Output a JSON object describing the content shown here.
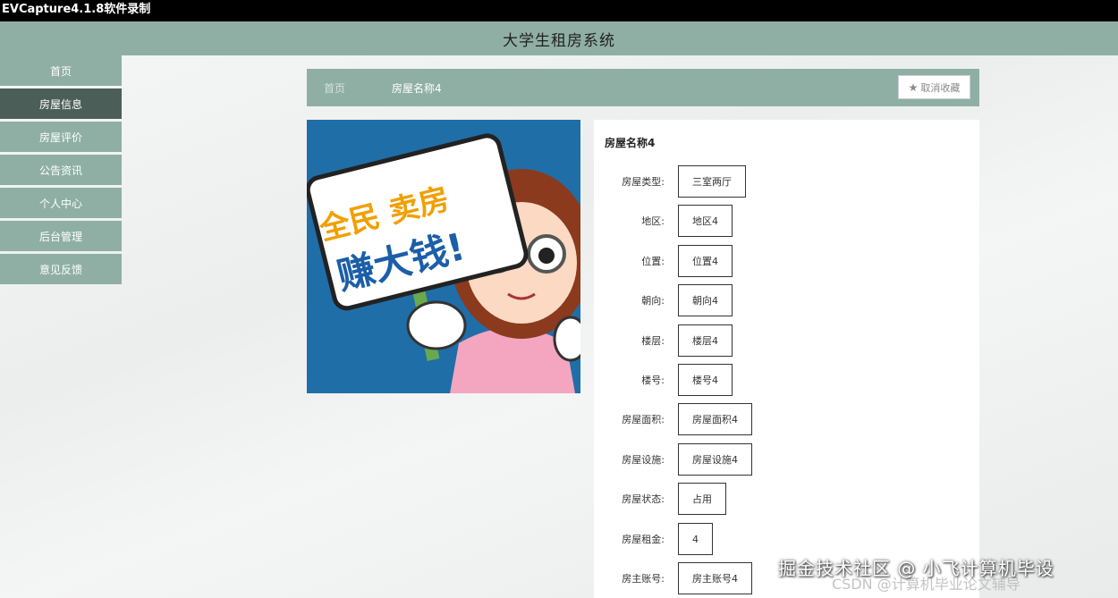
{
  "recorder_bar": {
    "text": "EVCapture4.1.8软件录制"
  },
  "header": {
    "title": "大学生租房系统"
  },
  "sidebar": {
    "items": [
      {
        "label": "首页",
        "active": false
      },
      {
        "label": "房屋信息",
        "active": true
      },
      {
        "label": "房屋评价",
        "active": false
      },
      {
        "label": "公告资讯",
        "active": false
      },
      {
        "label": "个人中心",
        "active": false
      },
      {
        "label": "后台管理",
        "active": false
      },
      {
        "label": "意见反馈",
        "active": false
      }
    ]
  },
  "breadcrumb": {
    "home": "首页",
    "current": "房屋名称4"
  },
  "favorite": {
    "icon": "star-icon",
    "label": "取消收藏"
  },
  "poster": {
    "line1": "全民 卖房",
    "line2": "赚大钱!"
  },
  "detail": {
    "name": "房屋名称4",
    "fields": [
      {
        "label": "房屋类型:",
        "value": "三室两厅"
      },
      {
        "label": "地区:",
        "value": "地区4"
      },
      {
        "label": "位置:",
        "value": "位置4"
      },
      {
        "label": "朝向:",
        "value": "朝向4"
      },
      {
        "label": "楼层:",
        "value": "楼层4"
      },
      {
        "label": "楼号:",
        "value": "楼号4"
      },
      {
        "label": "房屋面积:",
        "value": "房屋面积4"
      },
      {
        "label": "房屋设施:",
        "value": "房屋设施4"
      },
      {
        "label": "房屋状态:",
        "value": "占用"
      },
      {
        "label": "房屋租金:",
        "value": "4"
      },
      {
        "label": "房主账号:",
        "value": "房主账号4"
      }
    ]
  },
  "watermark": {
    "main": "掘金技术社区 @ 小飞计算机毕设",
    "sub": "CSDN @计算机毕业论文辅导"
  },
  "colors": {
    "nav": "#8fafa5",
    "nav_active": "#4b5f58",
    "poster_bg": "#1f6ea8"
  }
}
